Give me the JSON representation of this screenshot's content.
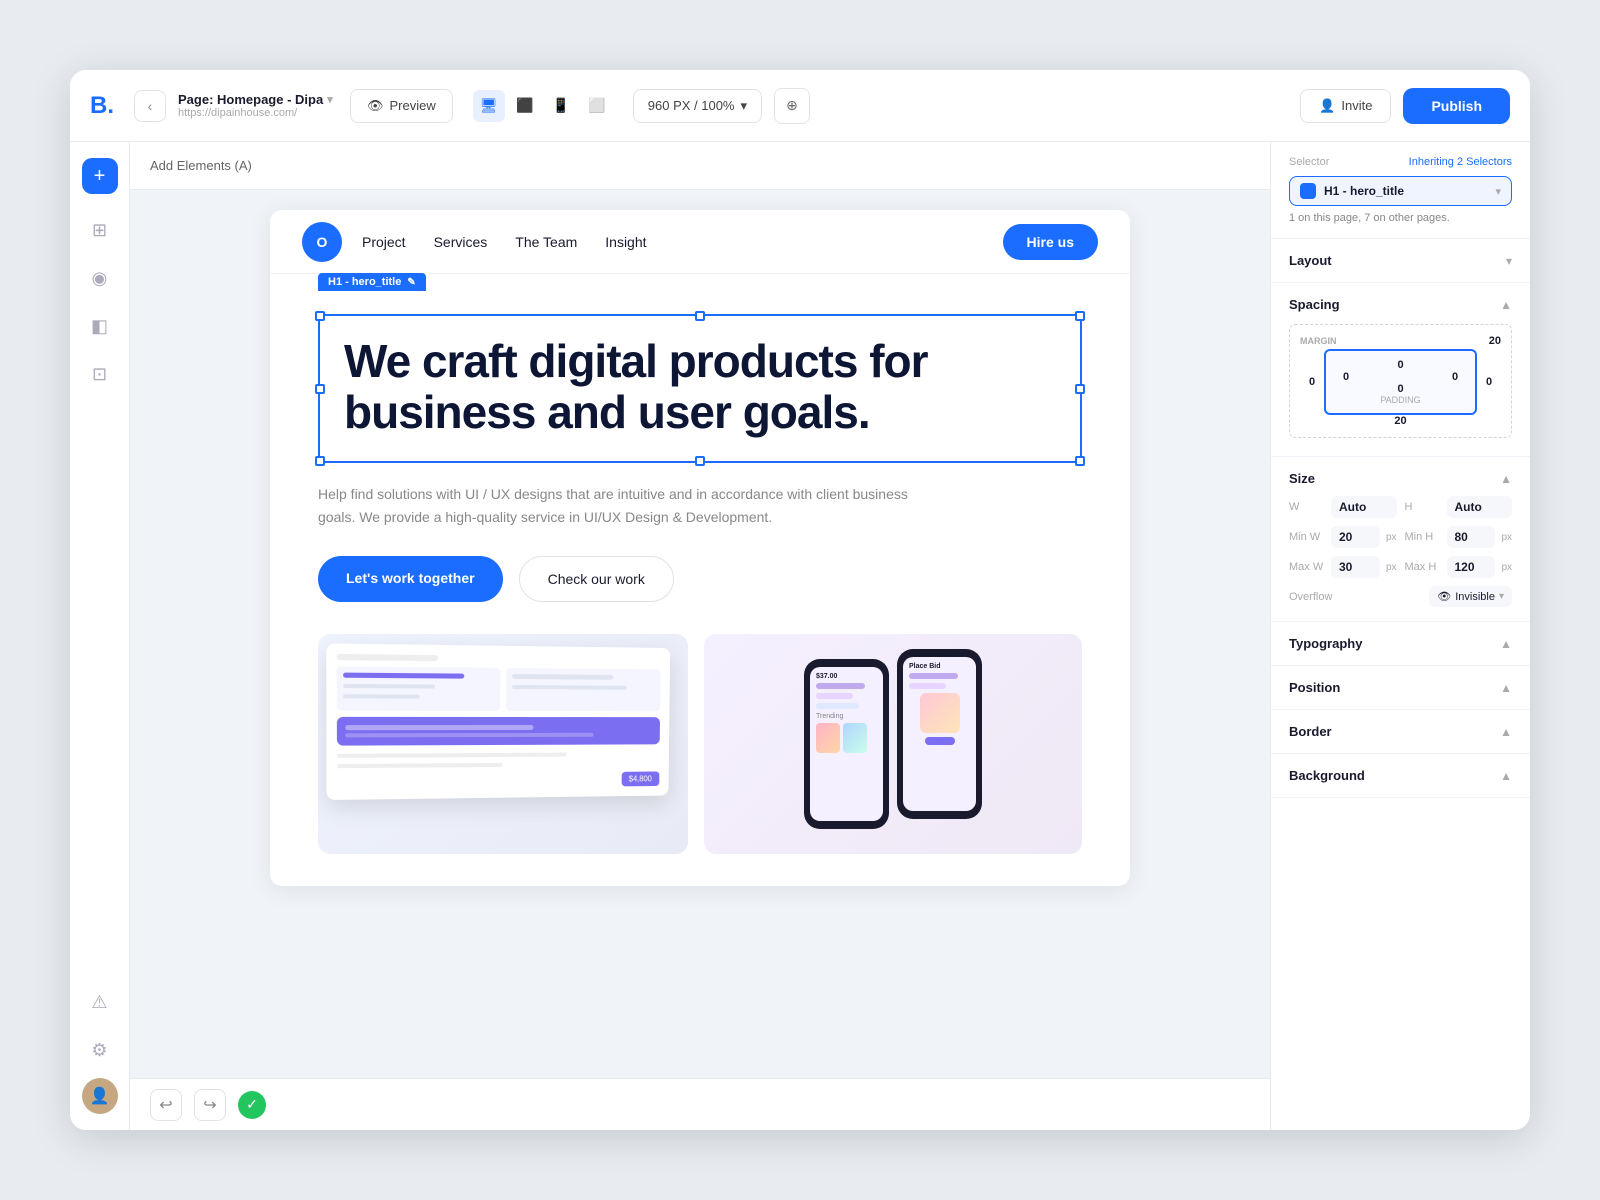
{
  "topbar": {
    "logo": "B.",
    "back_label": "‹",
    "page_title": "Page: Homepage - Dipa",
    "page_title_chevron": "▾",
    "page_url": "https://dipainhouse.com/",
    "preview_label": "Preview",
    "resolution_label": "960 PX / 100%",
    "invite_label": "Invite",
    "publish_label": "Publish"
  },
  "left_sidebar": {
    "add_icon": "+",
    "icons": [
      "⊞",
      "🎨",
      "📄",
      "🖼"
    ],
    "bottom_icons": [
      "⚠",
      "⚙"
    ]
  },
  "canvas": {
    "add_elements_label": "Add Elements (A)"
  },
  "site": {
    "logo_text": "O",
    "nav_links": [
      {
        "label": "Project"
      },
      {
        "label": "Services"
      },
      {
        "label": "The Team"
      },
      {
        "label": "Insight"
      }
    ],
    "hire_btn": "Hire us",
    "selection_tag": "H1 - hero_title",
    "hero_title": "We craft digital products for business and user goals.",
    "hero_sub": "Help find solutions with UI / UX designs that are intuitive and in accordance with client business goals. We provide a high-quality service in UI/UX Design & Development.",
    "btn_primary": "Let's work together",
    "btn_outline": "Check our work"
  },
  "right_panel": {
    "selector_label": "Selector",
    "inheriting_label": "Inheriting 2 Selectors",
    "selector_tag": "H1 - hero_title",
    "selector_pages": "1 on this page, 7 on other pages.",
    "layout_label": "Layout",
    "spacing_label": "Spacing",
    "margin_label": "MARGIN",
    "margin_top": "20",
    "margin_right": "0",
    "margin_bottom": "20",
    "margin_left": "0",
    "padding_top": "0",
    "padding_right": "0",
    "padding_bottom": "0",
    "padding_left": "0",
    "padding_label": "PADDING",
    "size_label": "Size",
    "w_label": "W",
    "w_value": "Auto",
    "h_label": "H",
    "h_value": "Auto",
    "minw_label": "Min W",
    "minw_value": "20",
    "minw_unit": "px",
    "minh_label": "Min H",
    "minh_value": "80",
    "minh_unit": "px",
    "maxw_label": "Max W",
    "maxw_value": "30",
    "maxw_unit": "px",
    "maxh_label": "Max H",
    "maxh_value": "120",
    "maxh_unit": "px",
    "overflow_label": "Overflow",
    "overflow_value": "Invisible",
    "typography_label": "Typography",
    "position_label": "Position",
    "border_label": "Border",
    "background_label": "Background"
  },
  "bottom_bar": {
    "undo": "↩",
    "redo": "↪",
    "save_check": "✓"
  }
}
